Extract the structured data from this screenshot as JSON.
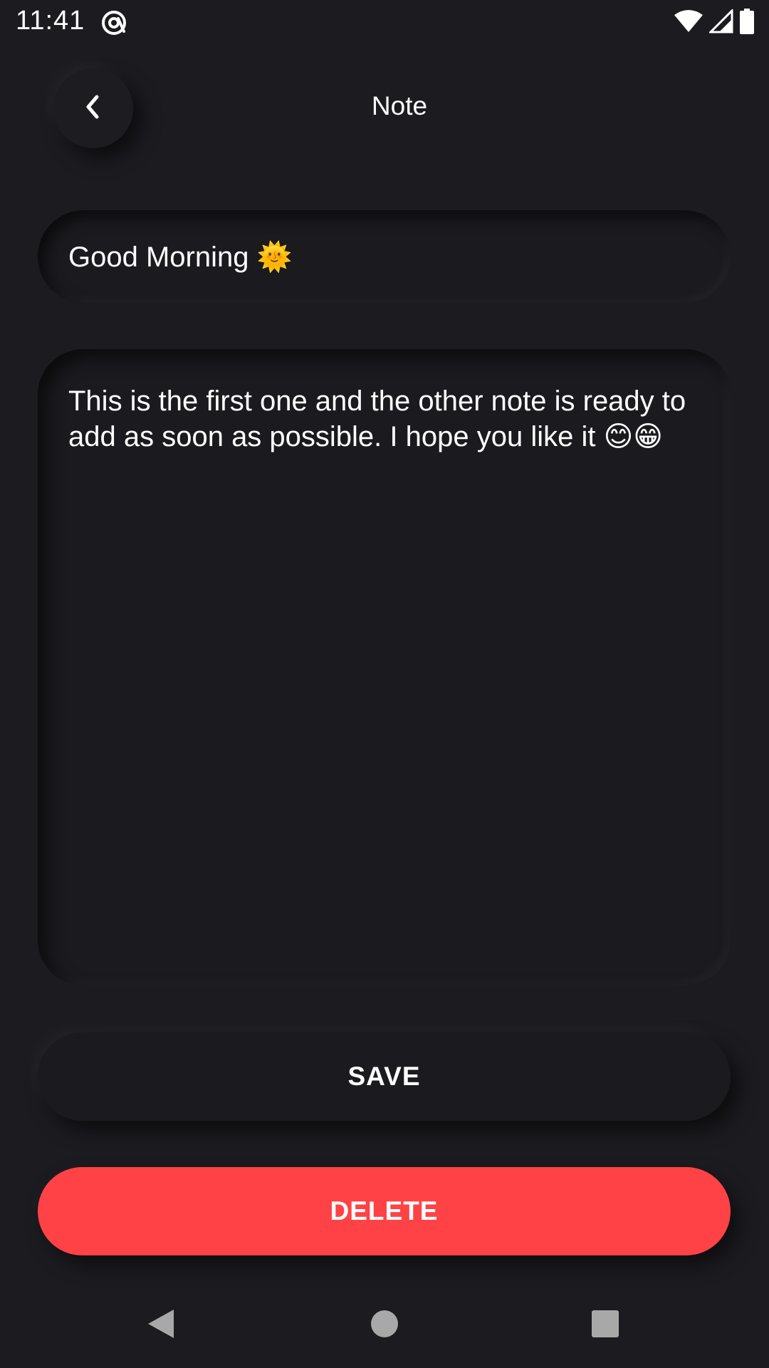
{
  "status_bar": {
    "time": "11:41",
    "app_icon": "at-sign-icon",
    "icons": [
      "wifi-icon",
      "signal-icon",
      "battery-icon"
    ]
  },
  "header": {
    "title": "Note",
    "back_icon": "chevron-left-icon"
  },
  "note": {
    "title_value": "Good Morning 🌞",
    "body_value": "This is the first one and the other note is ready to add as soon as possible. I hope you like it 😊😁"
  },
  "actions": {
    "save_label": "SAVE",
    "delete_label": "DELETE"
  },
  "nav_bar": {
    "icons": [
      "nav-back-icon",
      "nav-home-icon",
      "nav-recents-icon"
    ]
  },
  "colors": {
    "background": "#1c1b20",
    "surface": "#1b1a1f",
    "text": "#ffffff",
    "danger": "#ff4245",
    "nav_icon": "#a8a8a8"
  }
}
